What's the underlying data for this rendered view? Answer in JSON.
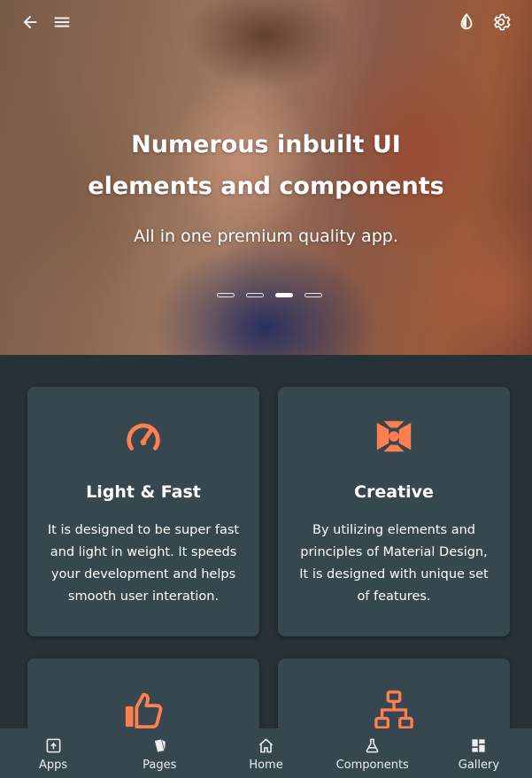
{
  "hero": {
    "title": "Numerous inbuilt UI elements and components",
    "subtitle": "All in one premium quality app.",
    "active_slide": 3,
    "slide_count": 4
  },
  "header_icons": [
    "back-arrow-icon",
    "menu-icon",
    "theme-drop-icon",
    "settings-gear-icon"
  ],
  "cards": [
    {
      "icon": "speedometer-icon",
      "title": "Light & Fast",
      "text": "It is designed to be super fast and light in weight. It speeds your development and helps smooth user interation."
    },
    {
      "icon": "aperture-icon",
      "title": "Creative",
      "text": "By utilizing elements and principles of Material Design, It is designed with unique set of features."
    },
    {
      "icon": "thumbs-up-icon",
      "title": "",
      "text": ""
    },
    {
      "icon": "sitemap-icon",
      "title": "",
      "text": ""
    }
  ],
  "bottom_nav": {
    "items": [
      {
        "label": "Apps",
        "icon": "apps-icon"
      },
      {
        "label": "Pages",
        "icon": "pages-icon"
      },
      {
        "label": "Home",
        "icon": "home-icon"
      },
      {
        "label": "Components",
        "icon": "flask-icon"
      },
      {
        "label": "Gallery",
        "icon": "gallery-icon"
      }
    ]
  },
  "colors": {
    "background": "#263238",
    "card": "#37474f",
    "accent": "#ff7f50",
    "text": "#ffffff"
  }
}
